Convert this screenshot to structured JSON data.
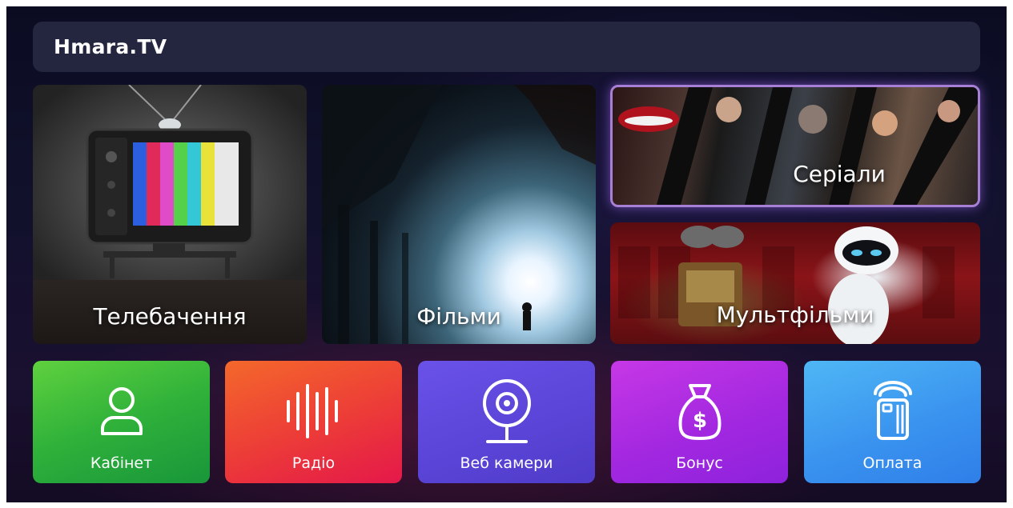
{
  "app": {
    "logo": "Hmara.TV"
  },
  "tiles": {
    "tv": {
      "label": "Телебачення"
    },
    "films": {
      "label": "Фільми"
    },
    "series": {
      "label": "Серіали"
    },
    "cartoons": {
      "label": "Мультфільми"
    }
  },
  "buttons": {
    "cabinet": {
      "label": "Кабінет",
      "icon": "user-icon"
    },
    "radio": {
      "label": "Радіо",
      "icon": "sound-wave-icon"
    },
    "webcam": {
      "label": "Веб камери",
      "icon": "webcam-icon"
    },
    "bonus": {
      "label": "Бонус",
      "icon": "money-bag-icon"
    },
    "payment": {
      "label": "Оплата",
      "icon": "card-payment-icon"
    }
  },
  "colors": {
    "cabinet": "#2fb13a",
    "radio": "#ec3b38",
    "webcam": "#5a45d8",
    "bonus": "#a328e0",
    "payment": "#3a94ef",
    "focus_border": "#a87fd6"
  }
}
